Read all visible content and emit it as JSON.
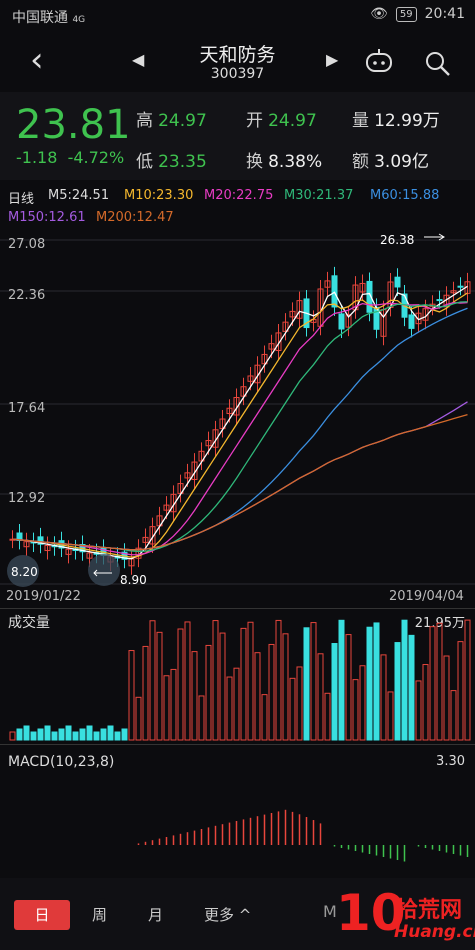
{
  "status": {
    "carrier": "中国联通",
    "network": "4G",
    "battery": "59",
    "time": "20:41"
  },
  "nav": {
    "title": "天和防务",
    "code": "300397",
    "back_icon": "chevron-left-icon",
    "robot_icon": "robot-icon",
    "search_icon": "search-icon"
  },
  "quote": {
    "price": "23.81",
    "change": "-1.18",
    "change_pct": "-4.72%",
    "high_label": "高",
    "high": "24.97",
    "open_label": "开",
    "open": "24.97",
    "volume_label": "量",
    "volume": "12.99万",
    "low_label": "低",
    "low": "23.35",
    "turnover_label": "换",
    "turnover": "8.38%",
    "amount_label": "额",
    "amount": "3.09亿"
  },
  "ma": {
    "period": "日线",
    "items": [
      {
        "label": "M5:24.51",
        "color": "#ffffff"
      },
      {
        "label": "M10:23.30",
        "color": "#f5b82e"
      },
      {
        "label": "M20:22.75",
        "color": "#e83cc4"
      },
      {
        "label": "M30:21.37",
        "color": "#2fb87a"
      },
      {
        "label": "M60:15.88",
        "color": "#3b8fe0"
      },
      {
        "label": "M150:12.61",
        "color": "#a45be0"
      },
      {
        "label": "M200:12.47",
        "color": "#d46a2a"
      }
    ]
  },
  "kline": {
    "y_ticks": [
      "27.08",
      "22.36",
      "17.64",
      "12.92"
    ],
    "high_mark": "26.38",
    "low_mark": "8.90",
    "left_mark": "8.20",
    "start_date": "2019/01/22",
    "end_date": "2019/04/04"
  },
  "volume": {
    "label": "成交量",
    "max": "21.95万"
  },
  "macd": {
    "label": "MACD(10,23,8)",
    "value": "3.30"
  },
  "footer": {
    "tabs": [
      "日",
      "周",
      "月",
      "更多"
    ],
    "active": "日",
    "more_arrow": "^",
    "watermark_big": "10",
    "watermark_text": "拾荒网",
    "watermark_url": "Huang.cn"
  }
}
